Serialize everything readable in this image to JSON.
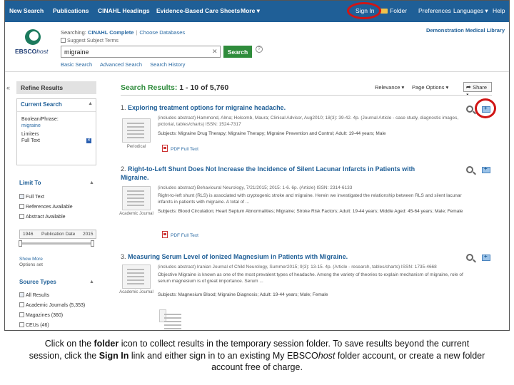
{
  "nav": {
    "items": [
      "New Search",
      "Publications",
      "CINAHL Headings",
      "Evidence-Based Care Sheets",
      "More ▾"
    ],
    "right": {
      "sign_in": "Sign In",
      "folder": "Folder",
      "preferences": "Preferences",
      "languages": "Languages ▾",
      "help": "Help"
    }
  },
  "header": {
    "logo_text": "EBSCO",
    "logo_text_italic": "host",
    "searching_label": "Searching:",
    "database": "CINAHL Complete",
    "choose_databases": "Choose Databases",
    "suggest_subject": "Suggest Subject Terms",
    "search_value": "migraine",
    "search_button": "Search",
    "links": [
      "Basic Search",
      "Advanced Search",
      "Search History"
    ],
    "institution": "Demonstration Medical Library"
  },
  "sidebar": {
    "refine_title": "Refine Results",
    "current_search": {
      "title": "Current Search",
      "boolean_label": "Boolean/Phrase:",
      "boolean_value": "migraine",
      "limiters_label": "Limiters",
      "limiter_value": "Full Text"
    },
    "limit_to": {
      "title": "Limit To",
      "options": [
        "Full Text",
        "References Available",
        "Abstract Available"
      ],
      "date_from": "1946",
      "date_label": "Publication Date",
      "date_to": "2015",
      "show_more": "Show More",
      "options_set": "Options set"
    },
    "source_types": {
      "title": "Source Types",
      "options": [
        "All Results",
        "Academic Journals (5,353)",
        "Magazines (360)",
        "CEUs (46)"
      ]
    }
  },
  "results": {
    "header_prefix": "Search Results:",
    "header_range": "1 - 10 of 5,760",
    "relevance": "Relevance ▾",
    "page_options": "Page Options ▾",
    "share": "Share ▾",
    "items": [
      {
        "num": "1.",
        "title": "Exploring treatment options for migraine headache.",
        "meta": "(includes abstract) Hammond, Alma; Holcomb, Maura; Clinical Advisor, Aug2010; 18(3): 39-42. 4p. (Journal Article - case study, diagnostic images, pictorial, tables/charts) ISSN: 1524-7317",
        "subjects": "Subjects: Migraine Drug Therapy; Migraine Therapy; Migraine Prevention and Control; Adult: 19-44 years; Male",
        "type_label": "Periodical",
        "pdf": "PDF Full Text"
      },
      {
        "num": "2.",
        "title": "Right-to-Left Shunt Does Not Increase the Incidence of Silent Lacunar Infarcts in Patients with",
        "title_line2": "Migraine.",
        "meta": "(includes abstract) Behavioural Neurology, 7/21/2015; 2015: 1-6. 6p. (Article) ISSN: 2314-6133",
        "abstract": "Right-to-left shunt (RLS) is associated with cryptogenic stroke and migraine. Herein we investigated the relationship between RLS and silent lacunar infarcts in patients with migraine. A total of ...",
        "subjects": "Subjects: Blood Circulation; Heart Septum Abnormalities; Migraine; Stroke Risk Factors; Adult: 19-44 years; Middle Aged: 45-64 years; Male; Female",
        "type_label": "Academic Journal",
        "pdf": "PDF Full Text"
      },
      {
        "num": "3.",
        "title": "Measuring Serum Level of Ionized Magnesium in Patients with Migraine.",
        "meta": "(includes abstract) Iranian Journal of Child Neurology, Summer2015; 9(3): 13-15. 4p. (Article - research, tables/charts) ISSN: 1735-4668",
        "abstract": "Objective Migraine is known as one of the most prevalent types of headache. Among the variety of theories to explain mechanism of migraine, role of serum magnesium is of great importance. Serum ...",
        "subjects": "Subjects: Magnesium Blood; Migraine Diagnosis; Adult: 19-44 years; Male; Female",
        "type_label": "Academic Journal"
      }
    ]
  },
  "caption": {
    "p1": "Click on the ",
    "b1": "folder",
    "p2": " icon to collect results in the temporary session folder. To save results beyond the current session, click the ",
    "b2": "Sign In",
    "p3": " link and either sign in to an existing My EBSCO",
    "i1": "host",
    "p4": " folder account, or create a new folder account free of charge."
  },
  "colors": {
    "nav_bg": "#1f5f97",
    "accent_green": "#2f8c3c",
    "highlight_circle": "#d01515"
  }
}
